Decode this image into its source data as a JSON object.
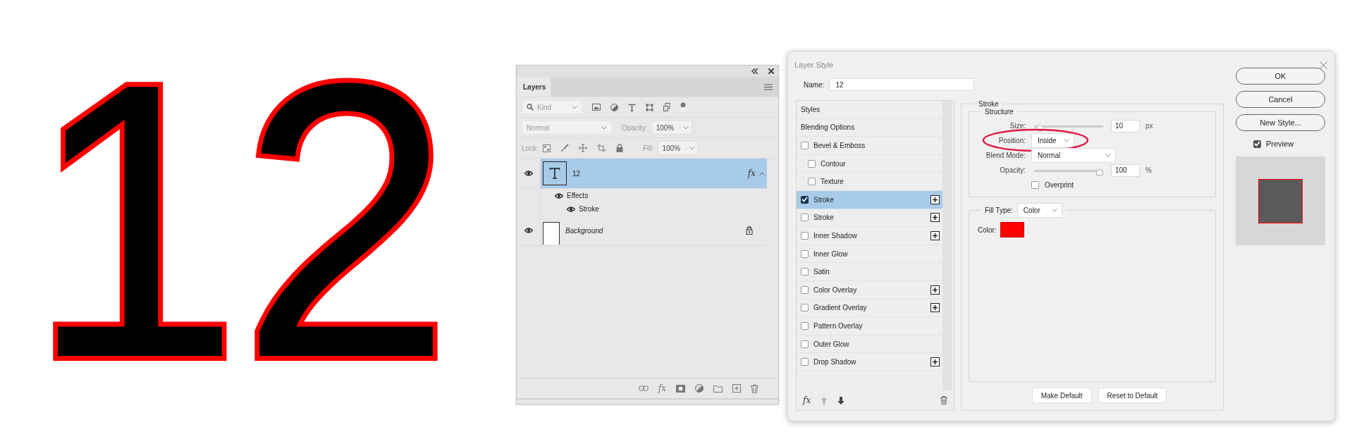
{
  "artwork": {
    "text": "12"
  },
  "layers_panel": {
    "tab": "Layers",
    "filter": "Kind",
    "blend_mode": "Normal",
    "opacity_label": "Opacity:",
    "opacity": "100%",
    "lock_label": "Lock:",
    "fill_label": "Fill:",
    "fill": "100%",
    "toolbar_fx": "fx",
    "layers": [
      {
        "name": "12",
        "kind": "text",
        "selected": true,
        "visible": true,
        "locked": false,
        "fx": "fx",
        "effects_label": "Effects",
        "effects": [
          {
            "name": "Stroke",
            "visible": true
          }
        ]
      },
      {
        "name": "Background",
        "kind": "image",
        "selected": false,
        "visible": true,
        "locked": true
      }
    ]
  },
  "dialog": {
    "title": "Layer Style",
    "name_label": "Name:",
    "name": "12",
    "footer_fx": "fx",
    "styles": [
      {
        "label": "Styles",
        "kind": "header",
        "selected": false
      },
      {
        "label": "Blending Options",
        "kind": "header",
        "selected": false
      },
      {
        "label": "Bevel & Emboss",
        "kind": "effect",
        "checked": false,
        "selected": false,
        "addable": false,
        "children": [
          {
            "label": "Contour",
            "kind": "effect",
            "checked": false,
            "selected": false,
            "addable": false
          },
          {
            "label": "Texture",
            "kind": "effect",
            "checked": false,
            "selected": false,
            "addable": false
          }
        ]
      },
      {
        "label": "Stroke",
        "kind": "effect",
        "checked": true,
        "selected": true,
        "addable": true
      },
      {
        "label": "Stroke",
        "kind": "effect",
        "checked": false,
        "selected": false,
        "addable": true
      },
      {
        "label": "Inner Shadow",
        "kind": "effect",
        "checked": false,
        "selected": false,
        "addable": true
      },
      {
        "label": "Inner Glow",
        "kind": "effect",
        "checked": false,
        "selected": false,
        "addable": false
      },
      {
        "label": "Satin",
        "kind": "effect",
        "checked": false,
        "selected": false,
        "addable": false
      },
      {
        "label": "Color Overlay",
        "kind": "effect",
        "checked": false,
        "selected": false,
        "addable": true
      },
      {
        "label": "Gradient Overlay",
        "kind": "effect",
        "checked": false,
        "selected": false,
        "addable": true
      },
      {
        "label": "Pattern Overlay",
        "kind": "effect",
        "checked": false,
        "selected": false,
        "addable": false
      },
      {
        "label": "Outer Glow",
        "kind": "effect",
        "checked": false,
        "selected": false,
        "addable": false
      },
      {
        "label": "Drop Shadow",
        "kind": "effect",
        "checked": false,
        "selected": false,
        "addable": true
      }
    ],
    "section": "Stroke",
    "structure": "Structure",
    "size": {
      "label": "Size:",
      "value": "10",
      "unit": "px",
      "level": 0.04
    },
    "position": {
      "label": "Position:",
      "value": "Inside",
      "highlighted": true
    },
    "blend": {
      "label": "Blend Mode:",
      "value": "Normal"
    },
    "opacity": {
      "label": "Opacity:",
      "value": "100",
      "unit": "%",
      "level": 1
    },
    "overprint": {
      "label": "Overprint",
      "checked": false
    },
    "fill_type": {
      "label": "Fill Type:",
      "value": "Color"
    },
    "color": {
      "label": "Color:",
      "color": "#ff0000"
    },
    "buttons": [
      "Make Default",
      "Reset to Default"
    ],
    "side_buttons": [
      "OK",
      "Cancel",
      "New Style..."
    ],
    "preview": {
      "label": "Preview",
      "checked": true
    }
  }
}
